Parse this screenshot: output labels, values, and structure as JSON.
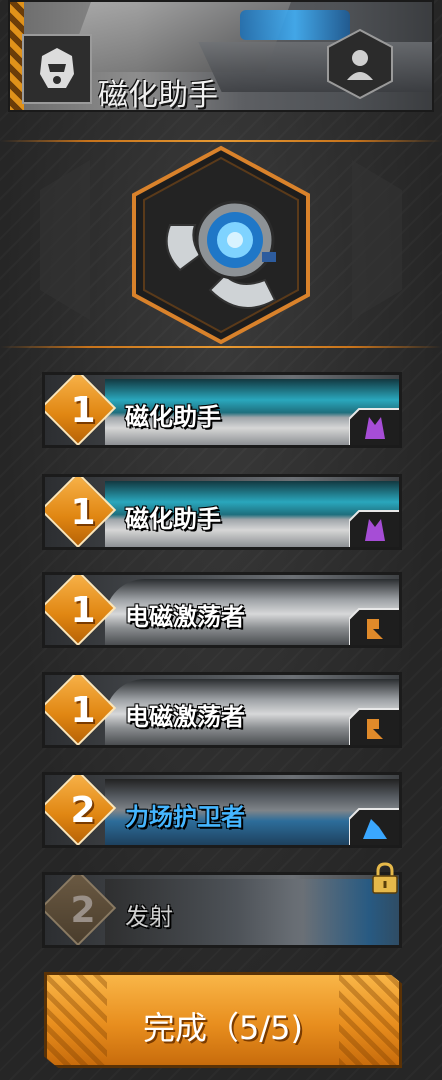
{
  "header": {
    "title": "磁化助手"
  },
  "abilities": [
    {
      "level": "1",
      "name": "磁化助手",
      "style": "teal"
    },
    {
      "level": "1",
      "name": "磁化助手",
      "style": "teal"
    },
    {
      "level": "1",
      "name": "电磁激荡者",
      "style": "grey"
    },
    {
      "level": "1",
      "name": "电磁激荡者",
      "style": "grey"
    },
    {
      "level": "2",
      "name": "力场护卫者",
      "style": "blue"
    },
    {
      "level": "2",
      "name": "发射",
      "style": "locked"
    }
  ],
  "complete_button": {
    "label": "完成（5/5)"
  },
  "colors": {
    "accent": "#e88e1e",
    "purple_badge": "#a64dd6",
    "orange_badge": "#e08a2a",
    "blue_badge": "#3aa7ff"
  }
}
